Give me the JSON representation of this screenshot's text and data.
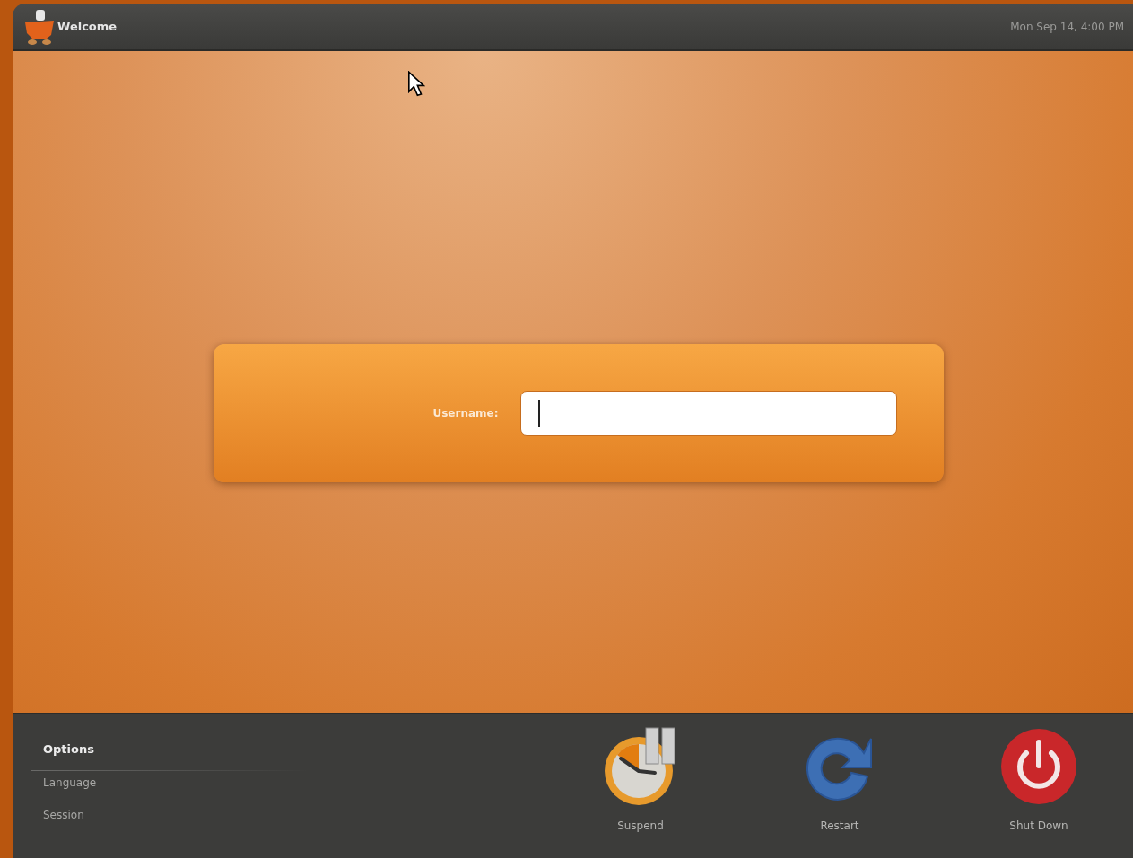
{
  "top_bar": {
    "title": "Welcome",
    "clock": "Mon Sep 14,  4:00 PM"
  },
  "login": {
    "label": "Username:"
  },
  "options": {
    "heading": "Options",
    "items": [
      "Language",
      "Session"
    ]
  },
  "actions": [
    {
      "kind": "suspend",
      "label": "Suspend"
    },
    {
      "kind": "restart",
      "label": "Restart"
    },
    {
      "kind": "shutdown",
      "label": "Shut Down"
    }
  ]
}
